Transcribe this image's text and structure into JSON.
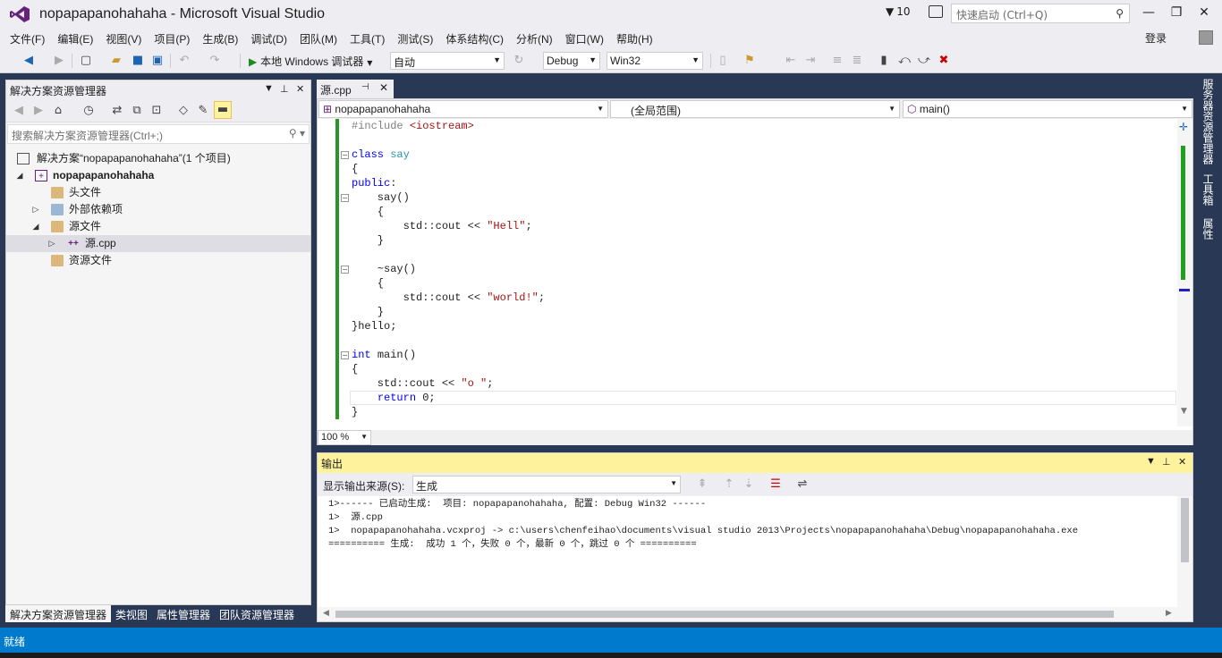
{
  "window": {
    "title": "nopapapanohahaha - Microsoft Visual Studio",
    "notification_count": "10",
    "quick_launch_placeholder": "快速启动 (Ctrl+Q)"
  },
  "menu": [
    "文件(F)",
    "编辑(E)",
    "视图(V)",
    "项目(P)",
    "生成(B)",
    "调试(D)",
    "团队(M)",
    "工具(T)",
    "测试(S)",
    "体系结构(C)",
    "分析(N)",
    "窗口(W)",
    "帮助(H)"
  ],
  "login_label": "登录",
  "toolbar": {
    "run_label": "本地 Windows 调试器",
    "solution_config_combo": "自动",
    "config": "Debug",
    "platform": "Win32"
  },
  "solution_explorer": {
    "title": "解决方案资源管理器",
    "search_placeholder": "搜索解决方案资源管理器(Ctrl+;)",
    "tree": [
      {
        "label": "解决方案“nopapapanohahaha”(1 个项目)",
        "level": 0,
        "arrow": "",
        "icon": "solution"
      },
      {
        "label": "nopapapanohahaha",
        "level": 0,
        "arrow": "◢",
        "icon": "project",
        "bold": true
      },
      {
        "label": "头文件",
        "level": 2,
        "arrow": "",
        "icon": "folder"
      },
      {
        "label": "外部依赖项",
        "level": 1,
        "arrow": "▷",
        "icon": "deps"
      },
      {
        "label": "源文件",
        "level": 1,
        "arrow": "◢",
        "icon": "folder"
      },
      {
        "label": "源.cpp",
        "level": 2,
        "arrow": "▷",
        "icon": "cpp",
        "selected": true
      },
      {
        "label": "资源文件",
        "level": 2,
        "arrow": "",
        "icon": "folder"
      }
    ],
    "bottom_tabs": [
      "解决方案资源管理器",
      "类视图",
      "属性管理器",
      "团队资源管理器"
    ]
  },
  "editor": {
    "tab_label": "源.cpp",
    "nav_project": "nopapapanohahaha",
    "nav_scope": "(全局范围)",
    "nav_member": "main()",
    "zoom": "100 %",
    "lines": [
      [
        {
          "t": "#include ",
          "c": "pp"
        },
        {
          "t": "<iostream>",
          "c": "str"
        }
      ],
      [],
      [
        {
          "t": "class ",
          "c": "kw"
        },
        {
          "t": "say",
          "c": "teal"
        }
      ],
      [
        {
          "t": "{",
          "c": ""
        }
      ],
      [
        {
          "t": "public",
          "c": "kw"
        },
        {
          "t": ":",
          "c": ""
        }
      ],
      [
        {
          "t": "    say()",
          "c": ""
        }
      ],
      [
        {
          "t": "    {",
          "c": ""
        }
      ],
      [
        {
          "t": "        std::cout << ",
          "c": ""
        },
        {
          "t": "\"Hell\"",
          "c": "str"
        },
        {
          "t": ";",
          "c": ""
        }
      ],
      [
        {
          "t": "    }",
          "c": ""
        }
      ],
      [],
      [
        {
          "t": "    ~say()",
          "c": ""
        }
      ],
      [
        {
          "t": "    {",
          "c": ""
        }
      ],
      [
        {
          "t": "        std::cout << ",
          "c": ""
        },
        {
          "t": "\"world!\"",
          "c": "str"
        },
        {
          "t": ";",
          "c": ""
        }
      ],
      [
        {
          "t": "    }",
          "c": ""
        }
      ],
      [
        {
          "t": "}hello;",
          "c": ""
        }
      ],
      [],
      [
        {
          "t": "int ",
          "c": "kw"
        },
        {
          "t": "main()",
          "c": ""
        }
      ],
      [
        {
          "t": "{",
          "c": ""
        }
      ],
      [
        {
          "t": "    std::cout << ",
          "c": ""
        },
        {
          "t": "\"o \"",
          "c": "str"
        },
        {
          "t": ";",
          "c": ""
        }
      ],
      [
        {
          "t": "    ",
          "c": ""
        },
        {
          "t": "return ",
          "c": "kw"
        },
        {
          "t": "0;",
          "c": ""
        }
      ],
      [
        {
          "t": "}",
          "c": ""
        }
      ]
    ]
  },
  "output": {
    "title": "输出",
    "source_label": "显示输出来源(S):",
    "source_value": "生成",
    "lines": [
      "1>------ 已启动生成:  项目: nopapapanohahaha, 配置: Debug Win32 ------",
      "1>  源.cpp",
      "1>  nopapapanohahaha.vcxproj -> c:\\users\\chenfeihao\\documents\\visual studio 2013\\Projects\\nopapapanohahaha\\Debug\\nopapapanohahaha.exe",
      "========== 生成:  成功 1 个，失败 0 个，最新 0 个，跳过 0 个 =========="
    ]
  },
  "right_tabs": [
    "服务器资源管理器",
    "工具箱",
    "属性"
  ],
  "status": "就绪"
}
